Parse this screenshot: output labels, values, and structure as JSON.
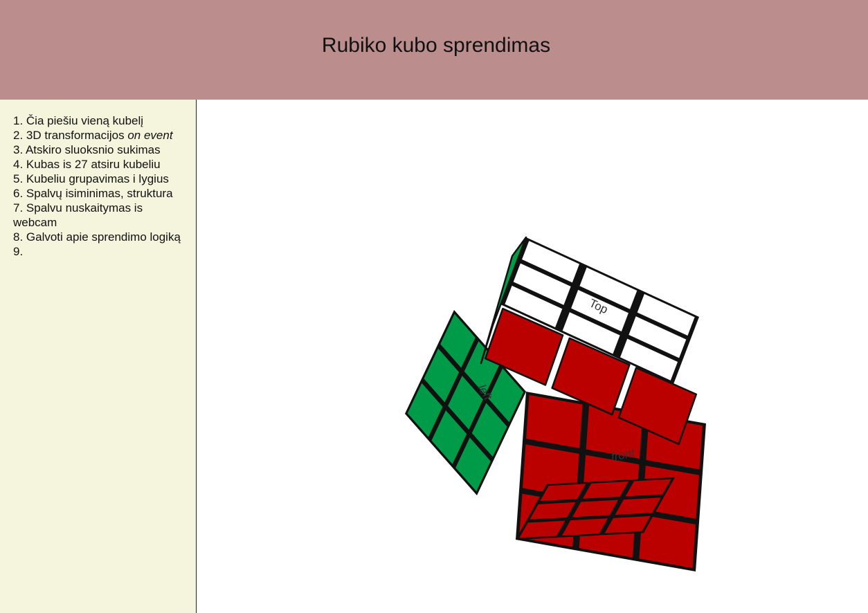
{
  "header": {
    "title": "Rubiko kubo sprendimas"
  },
  "sidebar": {
    "items": [
      {
        "text": "1. Čia piešiu vieną kubelį"
      },
      {
        "text": "2. 3D transformacijos ",
        "emphasis": "on event"
      },
      {
        "text": "3. Atskiro sluoksnio sukimas"
      },
      {
        "text": "4. Kubas is 27 atsiru kubeliu"
      },
      {
        "text": "5. Kubeliu grupavimas i lygius"
      },
      {
        "text": "6. Spalvų isiminimas, struktura"
      },
      {
        "text": "7. Spalvu nuskaitymas is webcam"
      },
      {
        "text": "8. Galvoti apie sprendimo logiką"
      },
      {
        "text": "9."
      }
    ]
  },
  "cube": {
    "labels": {
      "top": "Top",
      "left": "left",
      "front": "front"
    },
    "colors": {
      "white": "#ffffff",
      "red": "#bb0000",
      "green": "#009b48",
      "core_orange": "#ff6a00",
      "core_blue": "#2255cc",
      "edge": "#111111"
    }
  }
}
